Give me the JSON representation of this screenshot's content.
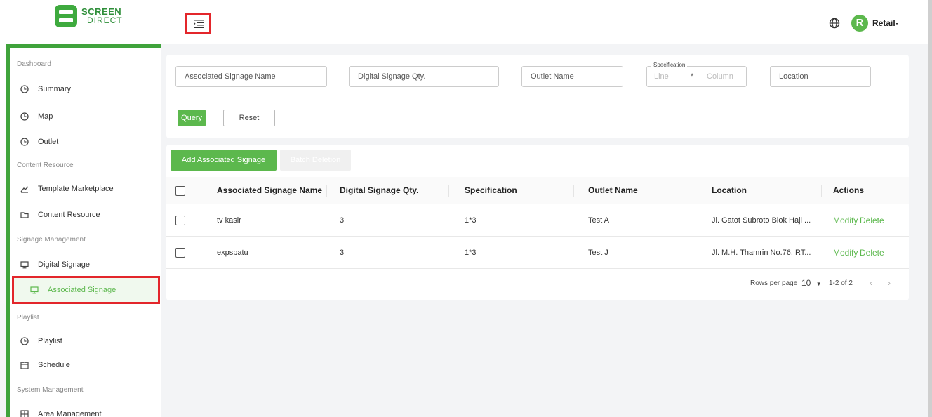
{
  "brand": {
    "line1": "SCREEN",
    "line2": "DIRECT"
  },
  "header": {
    "user_initial": "R",
    "user_name": "Retail-",
    "globe_icon": "◎"
  },
  "colors": {
    "accent": "#5cb84d",
    "highlight": "#e3262b"
  },
  "sidebar": {
    "sections": [
      {
        "label": "Dashboard",
        "items": [
          "Summary",
          "Map",
          "Outlet"
        ]
      },
      {
        "label": "Content Resource",
        "items": [
          "Template Marketplace",
          "Content Resource"
        ]
      },
      {
        "label": "Signage Management",
        "items": [
          "Digital Signage",
          "Associated Signage"
        ]
      },
      {
        "label": "Playlist",
        "items": [
          "Playlist",
          "Schedule"
        ]
      },
      {
        "label": "System Management",
        "items": [
          "Area Management"
        ]
      }
    ],
    "active_item": "Associated Signage"
  },
  "filters": {
    "associated_signage_name": "Associated Signage Name",
    "digital_signage_qty": "Digital Signage Qty.",
    "outlet_name": "Outlet Name",
    "specification_label": "Specification",
    "spec_line": "Line",
    "spec_sep": "*",
    "spec_column": "Column",
    "location": "Location",
    "query_label": "Query",
    "reset_label": "Reset"
  },
  "table": {
    "add_label": "Add Associated Signage",
    "batch_delete_label": "Batch Deletion",
    "columns": [
      "Associated Signage Name",
      "Digital Signage Qty.",
      "Specification",
      "Outlet Name",
      "Location",
      "Actions"
    ],
    "rows": [
      {
        "name": "tv kasir",
        "qty": "3",
        "spec": "1*3",
        "outlet": "Test A",
        "location": "Jl. Gatot Subroto Blok Haji ...",
        "modify": "Modify",
        "delete": "Delete"
      },
      {
        "name": "expspatu",
        "qty": "3",
        "spec": "1*3",
        "outlet": "Test J",
        "location": "Jl. M.H. Thamrin No.76, RT...",
        "modify": "Modify",
        "delete": "Delete"
      }
    ],
    "pagination": {
      "rows_per_page_label": "Rows per page",
      "rows_per_page": "10",
      "range": "1-2 of 2"
    }
  }
}
